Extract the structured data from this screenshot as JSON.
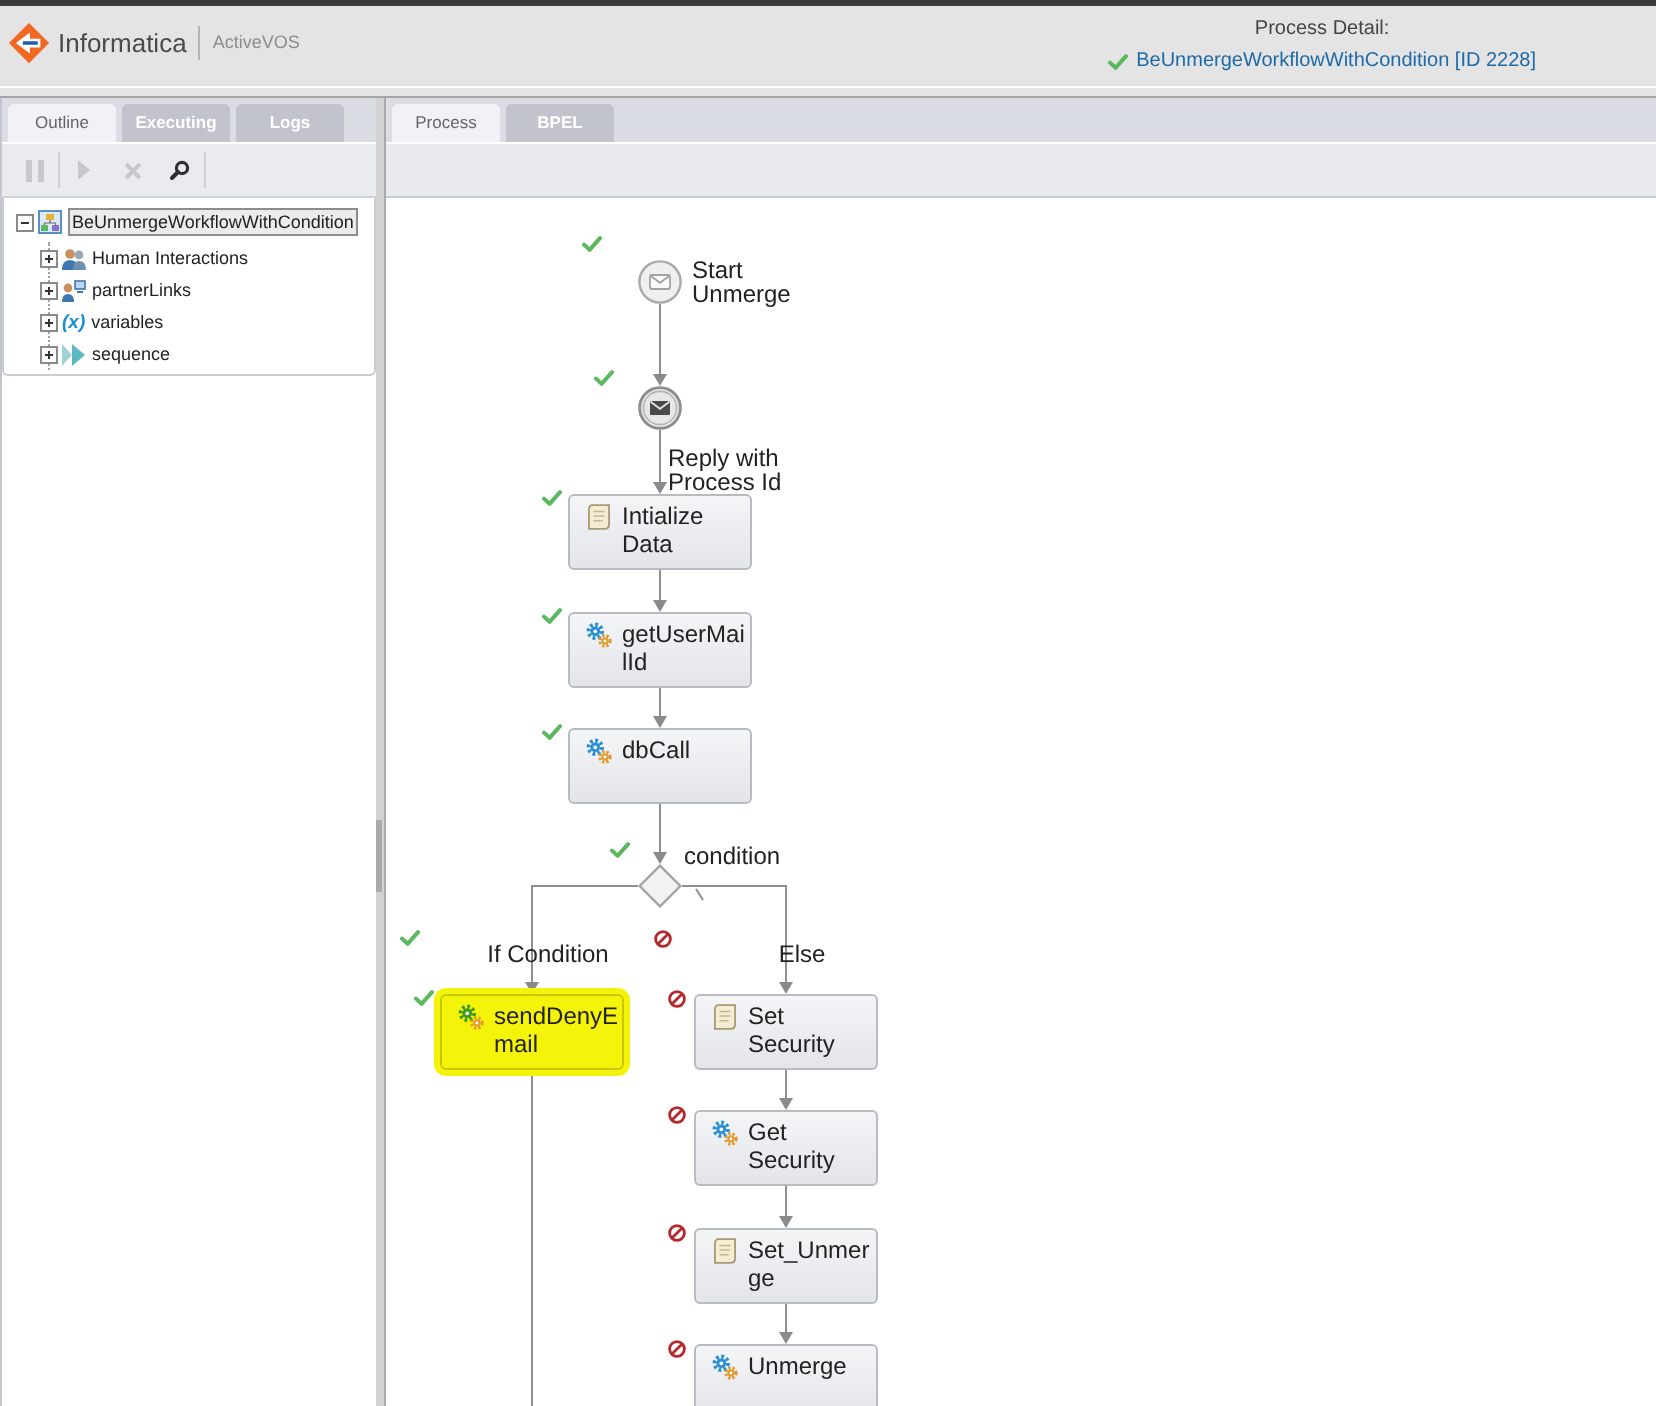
{
  "header": {
    "brand": "Informatica",
    "product": "ActiveVOS",
    "process_detail": {
      "label": "Process Detail:",
      "completed": true,
      "link": "BeUnmergeWorkflowWithCondition [ID 2228]"
    }
  },
  "left_panel": {
    "tabs": [
      {
        "label": "Outline",
        "selected": true
      },
      {
        "label": "Executing",
        "selected": false
      },
      {
        "label": "Logs",
        "selected": false
      }
    ],
    "toolbar": [
      {
        "items": [
          {
            "kind": "pause",
            "disabled": true
          }
        ]
      },
      {
        "items": [
          {
            "kind": "play",
            "disabled": true
          },
          {
            "kind": "delete",
            "disabled": true
          },
          {
            "kind": "search",
            "disabled": false
          }
        ]
      }
    ],
    "tree": {
      "label": "BeUnmergeWorkflowWithCondition",
      "expanded": true,
      "selected": true,
      "children": [
        {
          "label": "Human Interactions",
          "kind": "people",
          "expanded": false
        },
        {
          "label": "partnerLinks",
          "kind": "partner_links",
          "expanded": false
        },
        {
          "label": "variables",
          "kind": "variables",
          "icon_text": "(x)",
          "expanded": false
        },
        {
          "label": "sequence",
          "kind": "sequence",
          "expanded": false
        }
      ]
    }
  },
  "right_panel": {
    "tabs": [
      {
        "label": "Process",
        "selected": true
      },
      {
        "label": "BPEL",
        "selected": false
      }
    ],
    "diagram": {
      "events": [
        {
          "kind": "receive",
          "label": "Start\nUnmerge",
          "completed": true
        },
        {
          "kind": "reply",
          "label": "Reply with\nProcess Id",
          "completed": true
        }
      ],
      "sequence": [
        {
          "kind": "assign",
          "label": "Intialize\nData",
          "completed": true,
          "highlighted": false
        },
        {
          "kind": "invoke",
          "label": "getUserMai\nlId",
          "completed": true,
          "highlighted": false
        },
        {
          "kind": "invoke",
          "label": "dbCall",
          "completed": true,
          "highlighted": false
        }
      ],
      "condition": {
        "label": "condition",
        "completed": true
      },
      "branches": [
        {
          "kind": "if",
          "label": "If Condition",
          "completed": true,
          "activities": [
            {
              "kind": "invoke",
              "label": "sendDenyE\nmail",
              "completed": true,
              "highlighted": true
            }
          ]
        },
        {
          "kind": "else",
          "label": "Else",
          "completed": false,
          "activities": [
            {
              "kind": "assign",
              "label": "Set\nSecurity",
              "completed": false,
              "highlighted": false
            },
            {
              "kind": "invoke",
              "label": "Get\nSecurity",
              "completed": false,
              "highlighted": false
            },
            {
              "kind": "assign",
              "label": "Set_Unmer\nge",
              "completed": false,
              "highlighted": false
            },
            {
              "kind": "invoke",
              "label": "Unmerge",
              "completed": false,
              "highlighted": false
            }
          ]
        }
      ]
    }
  }
}
